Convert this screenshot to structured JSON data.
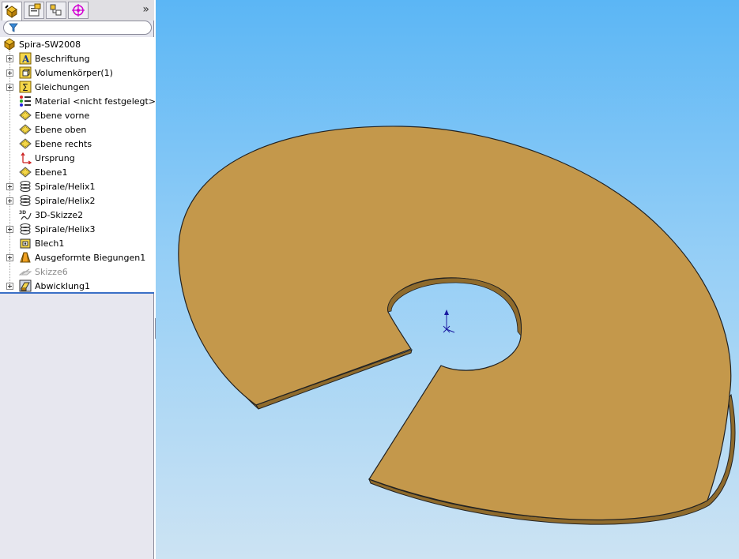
{
  "feature_tree": {
    "filter": {
      "placeholder": ""
    },
    "tabs": [
      {
        "icon": "feature-manager-icon"
      },
      {
        "icon": "property-manager-icon"
      },
      {
        "icon": "configuration-manager-icon"
      },
      {
        "icon": "dimxpert-icon"
      }
    ],
    "expand_arrow": "»",
    "root": {
      "label": "Spira-SW2008"
    },
    "items": [
      {
        "label": "Beschriftung",
        "icon": "annotations-icon",
        "expandable": true
      },
      {
        "label": "Volumenkörper(1)",
        "icon": "solid-bodies-icon",
        "expandable": true
      },
      {
        "label": "Gleichungen",
        "icon": "equations-icon",
        "expandable": true
      },
      {
        "label": "Material <nicht festgelegt>",
        "icon": "material-icon",
        "expandable": false
      },
      {
        "label": "Ebene vorne",
        "icon": "plane-icon",
        "expandable": false
      },
      {
        "label": "Ebene oben",
        "icon": "plane-icon",
        "expandable": false
      },
      {
        "label": "Ebene rechts",
        "icon": "plane-icon",
        "expandable": false
      },
      {
        "label": "Ursprung",
        "icon": "origin-icon",
        "expandable": false
      },
      {
        "label": "Ebene1",
        "icon": "plane-icon",
        "expandable": false
      },
      {
        "label": "Spirale/Helix1",
        "icon": "helix-icon",
        "expandable": true
      },
      {
        "label": "Spirale/Helix2",
        "icon": "helix-icon",
        "expandable": true
      },
      {
        "label": "3D-Skizze2",
        "icon": "3d-sketch-icon",
        "expandable": false
      },
      {
        "label": "Spirale/Helix3",
        "icon": "helix-icon",
        "expandable": true
      },
      {
        "label": "Blech1",
        "icon": "sheet-metal-icon",
        "expandable": false
      },
      {
        "label": "Ausgeformte Biegungen1",
        "icon": "lofted-bend-icon",
        "expandable": true
      },
      {
        "label": "Skizze6",
        "icon": "sketch-icon",
        "expandable": false,
        "dimmed": true
      },
      {
        "label": "Abwicklung1",
        "icon": "flatten-icon",
        "expandable": true
      }
    ]
  },
  "viewport": {
    "part_color": "#c4984b",
    "background_top": "#5bb6f5",
    "background_bottom": "#cce3f3"
  }
}
